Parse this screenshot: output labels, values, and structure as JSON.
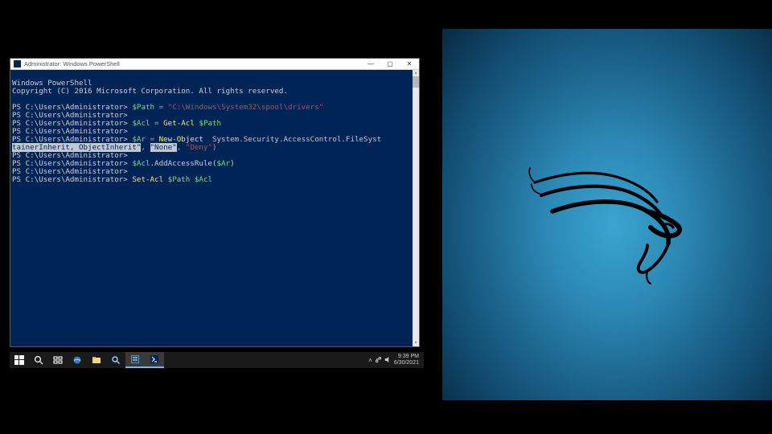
{
  "window": {
    "title": "Administrator: Windows PowerShell"
  },
  "terminal": {
    "header1": "Windows PowerShell",
    "header2": "Copyright (C) 2016 Microsoft Corporation. All rights reserved.",
    "prompt": "PS C:\\Users\\Administrator>",
    "lines": [
      {
        "prompt": "PS C:\\Users\\Administrator>",
        "segs": [
          {
            "t": " ",
            "c": "plain"
          },
          {
            "t": "$Path",
            "c": "var"
          },
          {
            "t": " = ",
            "c": "op"
          },
          {
            "t": "\"C:\\Windows\\System32\\spool\\drivers\"",
            "c": "str"
          }
        ]
      },
      {
        "prompt": "PS C:\\Users\\Administrator>",
        "segs": []
      },
      {
        "prompt": "PS C:\\Users\\Administrator>",
        "segs": [
          {
            "t": " ",
            "c": "plain"
          },
          {
            "t": "$Acl",
            "c": "var"
          },
          {
            "t": " = ",
            "c": "op"
          },
          {
            "t": "Get-Acl",
            "c": "cmd"
          },
          {
            "t": " ",
            "c": "plain"
          },
          {
            "t": "$Path",
            "c": "var"
          }
        ]
      },
      {
        "prompt": "PS C:\\Users\\Administrator>",
        "segs": []
      },
      {
        "prompt": "PS C:\\Users\\Administrator>",
        "segs": [
          {
            "t": " ",
            "c": "plain"
          },
          {
            "t": "$Ar",
            "c": "var"
          },
          {
            "t": " = ",
            "c": "op"
          },
          {
            "t": "New-Object",
            "c": "cmd"
          },
          {
            "t": "  System.Security.AccessControl.FileSyst",
            "c": "type"
          }
        ]
      },
      {
        "prompt": "",
        "segs": [
          {
            "t": "tainerInherit, ObjectInherit\"",
            "c": "sel"
          },
          {
            "t": ", ",
            "c": "op"
          },
          {
            "t": "\"None\"",
            "c": "sel"
          },
          {
            "t": ", ",
            "c": "op"
          },
          {
            "t": "\"Deny\"",
            "c": "str"
          },
          {
            "t": ")",
            "c": "op"
          }
        ]
      },
      {
        "prompt": "PS C:\\Users\\Administrator>",
        "segs": []
      },
      {
        "prompt": "PS C:\\Users\\Administrator>",
        "segs": [
          {
            "t": " ",
            "c": "plain"
          },
          {
            "t": "$Acl",
            "c": "var"
          },
          {
            "t": ".AddAccessRule(",
            "c": "plain"
          },
          {
            "t": "$Ar",
            "c": "var"
          },
          {
            "t": ")",
            "c": "plain"
          }
        ]
      },
      {
        "prompt": "PS C:\\Users\\Administrator>",
        "segs": []
      },
      {
        "prompt": "PS C:\\Users\\Administrator>",
        "segs": [
          {
            "t": " ",
            "c": "plain"
          },
          {
            "t": "Set-Acl",
            "c": "cmd"
          },
          {
            "t": " ",
            "c": "plain"
          },
          {
            "t": "$Path",
            "c": "var"
          },
          {
            "t": " ",
            "c": "plain"
          },
          {
            "t": "$Acl",
            "c": "var"
          }
        ]
      }
    ]
  },
  "taskbar": {
    "time": "9:39 PM",
    "date": "6/30/2021"
  }
}
